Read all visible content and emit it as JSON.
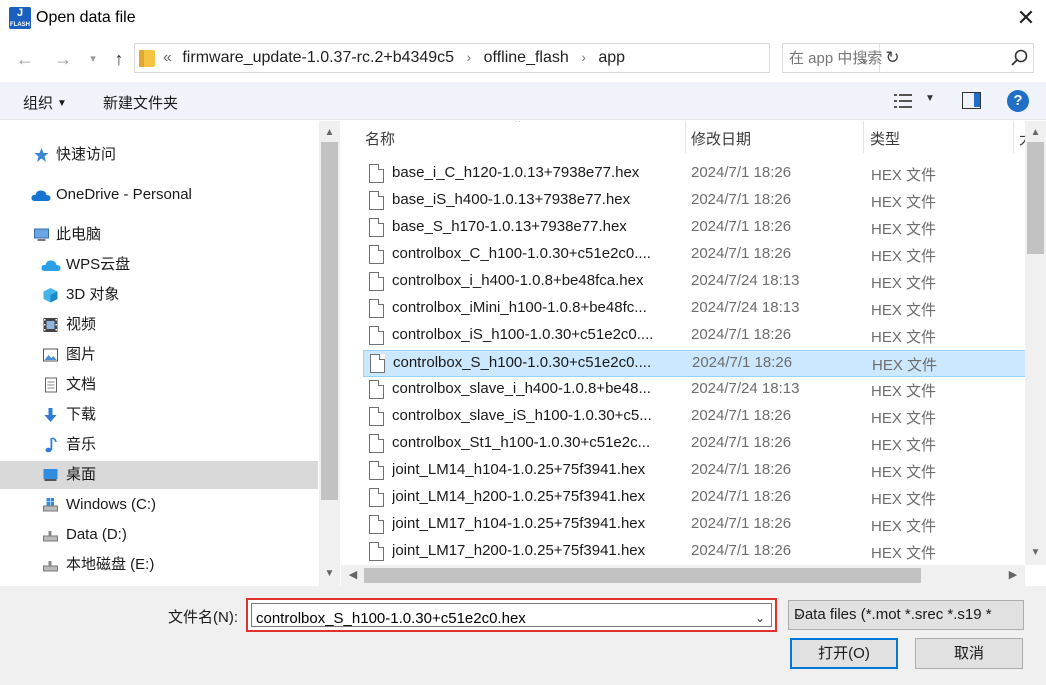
{
  "window": {
    "title": "Open data file",
    "app_icon_text_top": "J",
    "app_icon_text_bottom": "FLASH",
    "close_glyph": "✕"
  },
  "address": {
    "crumb_overflow": "«",
    "crumbs": [
      "firmware_update-1.0.37-rc.2+b4349c5",
      "offline_flash",
      "app"
    ],
    "search_placeholder": "在 app 中搜索"
  },
  "toolbar": {
    "organize_label": "组织",
    "new_folder_label": "新建文件夹",
    "help_label": "?"
  },
  "nav": {
    "items": [
      {
        "label": "快速访问",
        "icon": "quick-access-star-icon"
      },
      {
        "label": "OneDrive - Personal",
        "icon": "onedrive-cloud-icon"
      },
      {
        "label": "此电脑",
        "icon": "this-pc-icon"
      },
      {
        "label": "WPS云盘",
        "icon": "wps-cloud-icon"
      },
      {
        "label": "3D 对象",
        "icon": "3d-objects-icon"
      },
      {
        "label": "视频",
        "icon": "videos-icon"
      },
      {
        "label": "图片",
        "icon": "pictures-icon"
      },
      {
        "label": "文档",
        "icon": "documents-icon"
      },
      {
        "label": "下载",
        "icon": "downloads-icon"
      },
      {
        "label": "音乐",
        "icon": "music-icon"
      },
      {
        "label": "桌面",
        "icon": "desktop-icon"
      },
      {
        "label": "Windows (C:)",
        "icon": "drive-c-icon"
      },
      {
        "label": "Data (D:)",
        "icon": "drive-d-icon"
      },
      {
        "label": "本地磁盘 (E:)",
        "icon": "drive-e-icon"
      }
    ],
    "selected_index": 10
  },
  "files": {
    "columns": {
      "name": "名称",
      "date": "修改日期",
      "type": "类型",
      "size": "大"
    },
    "rows": [
      {
        "name": "base_i_C_h120-1.0.13+7938e77.hex",
        "date": "2024/7/1 18:26",
        "type": "HEX 文件"
      },
      {
        "name": "base_iS_h400-1.0.13+7938e77.hex",
        "date": "2024/7/1 18:26",
        "type": "HEX 文件"
      },
      {
        "name": "base_S_h170-1.0.13+7938e77.hex",
        "date": "2024/7/1 18:26",
        "type": "HEX 文件"
      },
      {
        "name": "controlbox_C_h100-1.0.30+c51e2c0....",
        "date": "2024/7/1 18:26",
        "type": "HEX 文件"
      },
      {
        "name": "controlbox_i_h400-1.0.8+be48fca.hex",
        "date": "2024/7/24 18:13",
        "type": "HEX 文件"
      },
      {
        "name": "controlbox_iMini_h100-1.0.8+be48fc...",
        "date": "2024/7/24 18:13",
        "type": "HEX 文件"
      },
      {
        "name": "controlbox_iS_h100-1.0.30+c51e2c0....",
        "date": "2024/7/1 18:26",
        "type": "HEX 文件"
      },
      {
        "name": "controlbox_S_h100-1.0.30+c51e2c0....",
        "date": "2024/7/1 18:26",
        "type": "HEX 文件"
      },
      {
        "name": "controlbox_slave_i_h400-1.0.8+be48...",
        "date": "2024/7/24 18:13",
        "type": "HEX 文件"
      },
      {
        "name": "controlbox_slave_iS_h100-1.0.30+c5...",
        "date": "2024/7/1 18:26",
        "type": "HEX 文件"
      },
      {
        "name": "controlbox_St1_h100-1.0.30+c51e2c...",
        "date": "2024/7/1 18:26",
        "type": "HEX 文件"
      },
      {
        "name": "joint_LM14_h104-1.0.25+75f3941.hex",
        "date": "2024/7/1 18:26",
        "type": "HEX 文件"
      },
      {
        "name": "joint_LM14_h200-1.0.25+75f3941.hex",
        "date": "2024/7/1 18:26",
        "type": "HEX 文件"
      },
      {
        "name": "joint_LM17_h104-1.0.25+75f3941.hex",
        "date": "2024/7/1 18:26",
        "type": "HEX 文件"
      },
      {
        "name": "joint_LM17_h200-1.0.25+75f3941.hex",
        "date": "2024/7/1 18:26",
        "type": "HEX 文件"
      }
    ],
    "selected_index": 7
  },
  "footer": {
    "filename_label": "文件名(N):",
    "filename_value": "controlbox_S_h100-1.0.30+c51e2c0.hex",
    "filetype_value": "Data files (*.mot *.srec *.s19 *",
    "open_label": "打开(O)",
    "cancel_label": "取消"
  },
  "colors": {
    "selection_bg": "#cce8ff",
    "nav_selection_bg": "#d9d9d9",
    "highlight_border": "#e0322c",
    "accent": "#0078d7"
  }
}
